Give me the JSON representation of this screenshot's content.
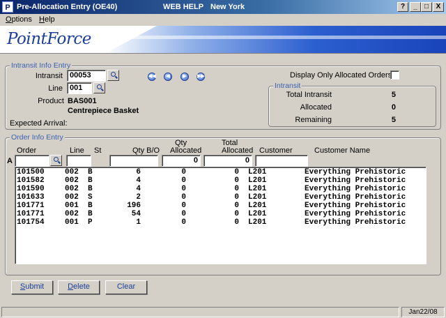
{
  "window": {
    "title": "Pre-Allocation Entry (OE40)",
    "help_label": "WEB HELP",
    "location": "New York",
    "app_icon": "P",
    "help_btn": "?",
    "minimize_btn": "_",
    "maximize_btn": "□",
    "close_btn": "X"
  },
  "menu": {
    "options_first": "O",
    "options_rest": "ptions",
    "help_first": "H",
    "help_rest": "elp"
  },
  "banner": {
    "logo": "PointForce"
  },
  "intransit_info": {
    "legend": "Intransit Info Entry",
    "intransit_label": "Intransit",
    "intransit_value": "00053",
    "line_label": "Line",
    "line_value": "001",
    "product_label": "Product",
    "product_code": "BAS001",
    "product_name": "Centrepiece Basket",
    "expected_arrival_label": "Expected Arrival:",
    "display_only_allocated_label": "Display Only Allocated Orders",
    "nav": {
      "first": "◀◀",
      "prev": "◀",
      "next": "▶",
      "last": "▶▶"
    }
  },
  "intransit_summary": {
    "legend": "Intransit",
    "total_intransit_label": "Total Intransit",
    "total_intransit": "5",
    "allocated_label": "Allocated",
    "allocated": "0",
    "remaining_label": "Remaining",
    "remaining": "5"
  },
  "order_info": {
    "legend": "Order Info Entry",
    "row_marker": "A",
    "columns": {
      "order": "Order",
      "line": "Line",
      "st": "St",
      "qty_bo": "Qty B/O",
      "qty_allocated_1": "Qty",
      "qty_allocated_2": "Allocated",
      "total_allocated_1": "Total",
      "total_allocated_2": "Allocated",
      "customer": "Customer",
      "customer_name": "Customer Name"
    },
    "entry": {
      "qty_allocated": "0",
      "total_allocated": "0"
    },
    "rows": [
      {
        "order": "101500",
        "line": "002",
        "st": "B",
        "qty_bo": "6",
        "qty_allocated": "0",
        "total_allocated": "0",
        "customer": "L201",
        "customer_name": "Everything Prehistoric"
      },
      {
        "order": "101582",
        "line": "002",
        "st": "B",
        "qty_bo": "4",
        "qty_allocated": "0",
        "total_allocated": "0",
        "customer": "L201",
        "customer_name": "Everything Prehistoric"
      },
      {
        "order": "101590",
        "line": "002",
        "st": "B",
        "qty_bo": "4",
        "qty_allocated": "0",
        "total_allocated": "0",
        "customer": "L201",
        "customer_name": "Everything Prehistoric"
      },
      {
        "order": "101633",
        "line": "002",
        "st": "S",
        "qty_bo": "2",
        "qty_allocated": "0",
        "total_allocated": "0",
        "customer": "L201",
        "customer_name": "Everything Prehistoric"
      },
      {
        "order": "101771",
        "line": "001",
        "st": "B",
        "qty_bo": "196",
        "qty_allocated": "0",
        "total_allocated": "0",
        "customer": "L201",
        "customer_name": "Everything Prehistoric"
      },
      {
        "order": "101771",
        "line": "002",
        "st": "B",
        "qty_bo": "54",
        "qty_allocated": "0",
        "total_allocated": "0",
        "customer": "L201",
        "customer_name": "Everything Prehistoric"
      },
      {
        "order": "101754",
        "line": "001",
        "st": "P",
        "qty_bo": "1",
        "qty_allocated": "0",
        "total_allocated": "0",
        "customer": "L201",
        "customer_name": "Everything Prehistoric"
      }
    ]
  },
  "buttons": {
    "submit_first": "S",
    "submit_rest": "ubmit",
    "delete_first": "D",
    "delete_rest": "elete",
    "clear": "Clear"
  },
  "status": {
    "date": "Jan22/08"
  }
}
